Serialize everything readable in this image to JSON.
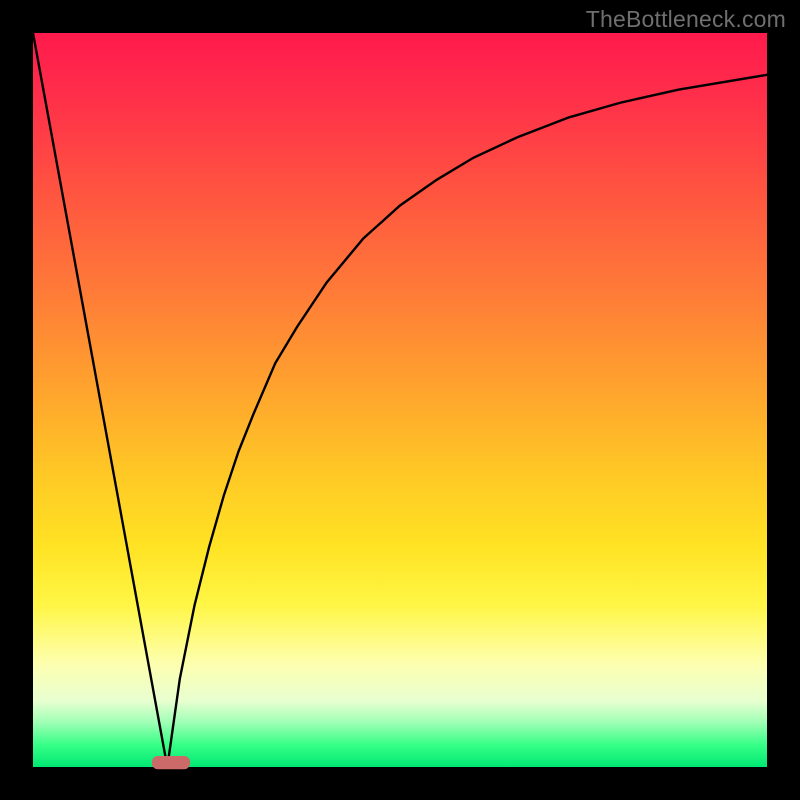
{
  "watermark": "TheBottleneck.com",
  "chart_data": {
    "type": "line",
    "title": "",
    "xlabel": "",
    "ylabel": "",
    "xlim": [
      0,
      100
    ],
    "ylim": [
      0,
      100
    ],
    "grid": false,
    "legend": false,
    "series": [
      {
        "name": "left-branch",
        "x": [
          0,
          18.3
        ],
        "y": [
          100,
          0.0
        ]
      },
      {
        "name": "right-branch",
        "x": [
          18.3,
          20,
          22,
          24,
          26,
          28,
          30,
          33,
          36,
          40,
          45,
          50,
          55,
          60,
          66,
          73,
          80,
          88,
          100
        ],
        "y": [
          0.0,
          12,
          22,
          30,
          37,
          43,
          48,
          55,
          60,
          66,
          72,
          76.5,
          80,
          83,
          85.8,
          88.5,
          90.5,
          92.3,
          94.3
        ]
      }
    ],
    "marker": {
      "name": "sweet-spot",
      "x_center": 18.8,
      "y": 0.6,
      "width": 5.2,
      "height": 1.8,
      "color": "#cc6a6a"
    },
    "background": "vertical-gradient red-orange-yellow-green",
    "line_color": "#000000"
  }
}
